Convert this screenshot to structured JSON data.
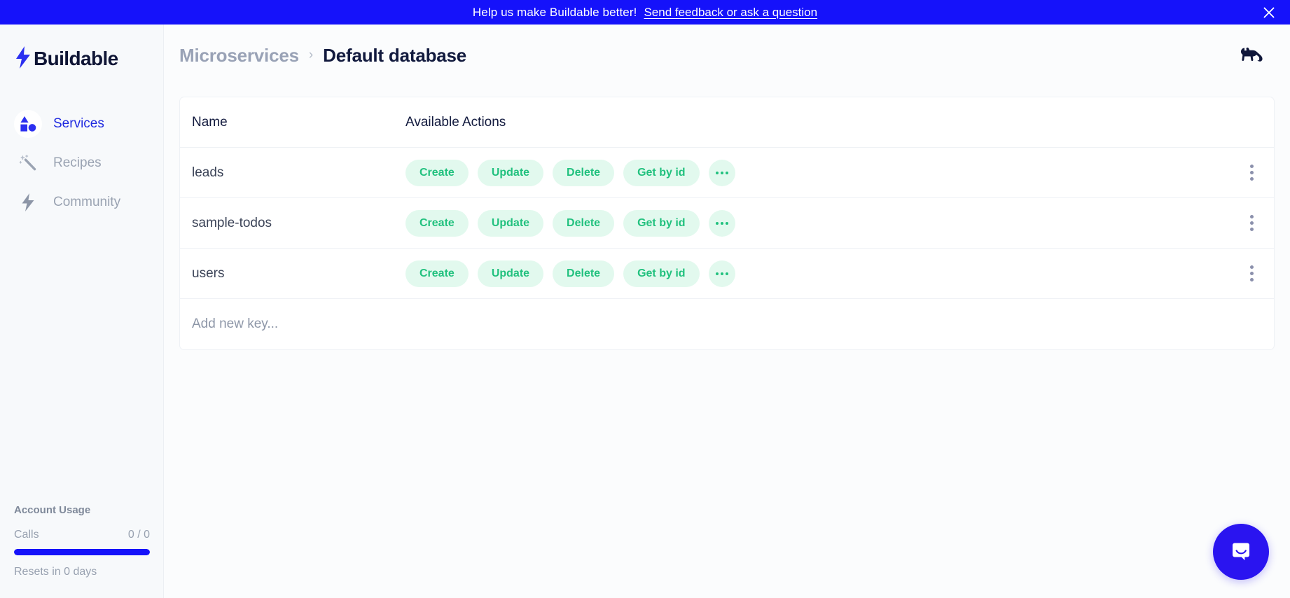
{
  "banner": {
    "message": "Help us make Buildable better!",
    "link_label": "Send feedback or ask a question",
    "close_icon": "close-icon",
    "background_color": "#1512fa"
  },
  "sidebar": {
    "brand": {
      "name": "Buildable",
      "logo_icon": "lightning-bolt-icon"
    },
    "items": [
      {
        "label": "Services",
        "icon": "shapes-icon",
        "active": true
      },
      {
        "label": "Recipes",
        "icon": "magic-wand-icon",
        "active": false
      },
      {
        "label": "Community",
        "icon": "lightning-bolt-icon",
        "active": false
      }
    ],
    "account_usage": {
      "title": "Account Usage",
      "metric_label": "Calls",
      "metric_value": "0 / 0",
      "progress_percent": 100,
      "progress_color": "#1512fa",
      "reset_text": "Resets in 0 days"
    }
  },
  "header": {
    "breadcrumb": {
      "parent": "Microservices",
      "separator": "›",
      "current": "Default database"
    },
    "avatar_icon": "lion-avatar-icon"
  },
  "table": {
    "columns": [
      "Name",
      "Available Actions"
    ],
    "rows": [
      {
        "name": "leads",
        "actions": [
          "Create",
          "Update",
          "Delete",
          "Get by id"
        ],
        "more_actions_label": "•••",
        "row_menu_icon": "kebab-menu-icon"
      },
      {
        "name": "sample-todos",
        "actions": [
          "Create",
          "Update",
          "Delete",
          "Get by id"
        ],
        "more_actions_label": "•••",
        "row_menu_icon": "kebab-menu-icon"
      },
      {
        "name": "users",
        "actions": [
          "Create",
          "Update",
          "Delete",
          "Get by id"
        ],
        "more_actions_label": "•••",
        "row_menu_icon": "kebab-menu-icon"
      }
    ],
    "add_new_placeholder": "Add new key...",
    "action_pill_bg": "#e2f9ee",
    "action_pill_color": "#21c17e"
  },
  "chat": {
    "icon": "chat-bubble-icon",
    "color": "#2a14f0"
  }
}
